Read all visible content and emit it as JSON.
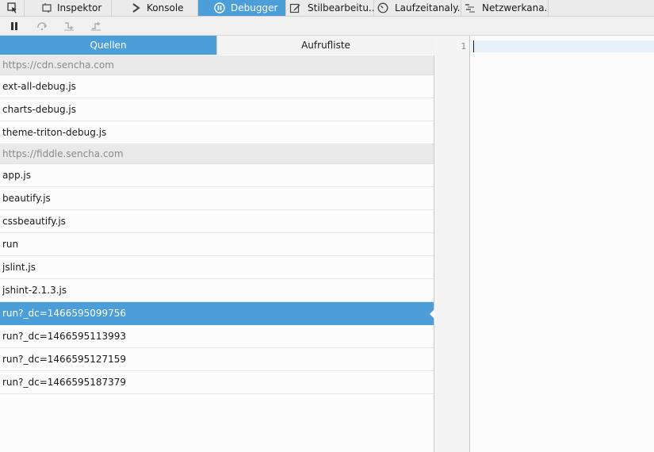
{
  "toolbox": {
    "picker_icon": "element-picker-icon",
    "tabs": [
      {
        "label": "Inspektor",
        "icon": "inspector-icon"
      },
      {
        "label": "Konsole",
        "icon": "console-icon"
      },
      {
        "label": "Debugger",
        "icon": "debugger-pause-icon"
      },
      {
        "label": "Stilbearbeitu...",
        "icon": "style-editor-icon"
      },
      {
        "label": "Laufzeitanaly...",
        "icon": "performance-icon"
      },
      {
        "label": "Netzwerkana...",
        "icon": "network-icon"
      }
    ],
    "active_tab": "Debugger"
  },
  "debugger_toolbar": [
    "pause-icon",
    "step-over-icon",
    "step-in-icon",
    "step-out-icon"
  ],
  "panes": {
    "tabs": [
      {
        "label": "Quellen"
      },
      {
        "label": "Aufrufliste"
      }
    ],
    "active": "Quellen"
  },
  "sources": {
    "groups": [
      {
        "origin": "https://cdn.sencha.com",
        "files": [
          "ext-all-debug.js",
          "charts-debug.js",
          "theme-triton-debug.js"
        ]
      },
      {
        "origin": "https://fiddle.sencha.com",
        "files": [
          "app.js",
          "beautify.js",
          "cssbeautify.js",
          "run",
          "jslint.js",
          "jshint-2.1.3.js",
          "run?_dc=1466595099756",
          "run?_dc=1466595113993",
          "run?_dc=1466595127159",
          "run?_dc=1466595187379"
        ]
      }
    ],
    "selected": "run?_dc=1466595099756"
  },
  "editor": {
    "line_number": "1"
  },
  "colors": {
    "accent": "#4c9ed9",
    "group_bg": "#e9e9e9",
    "group_text": "#8a8a8a"
  }
}
